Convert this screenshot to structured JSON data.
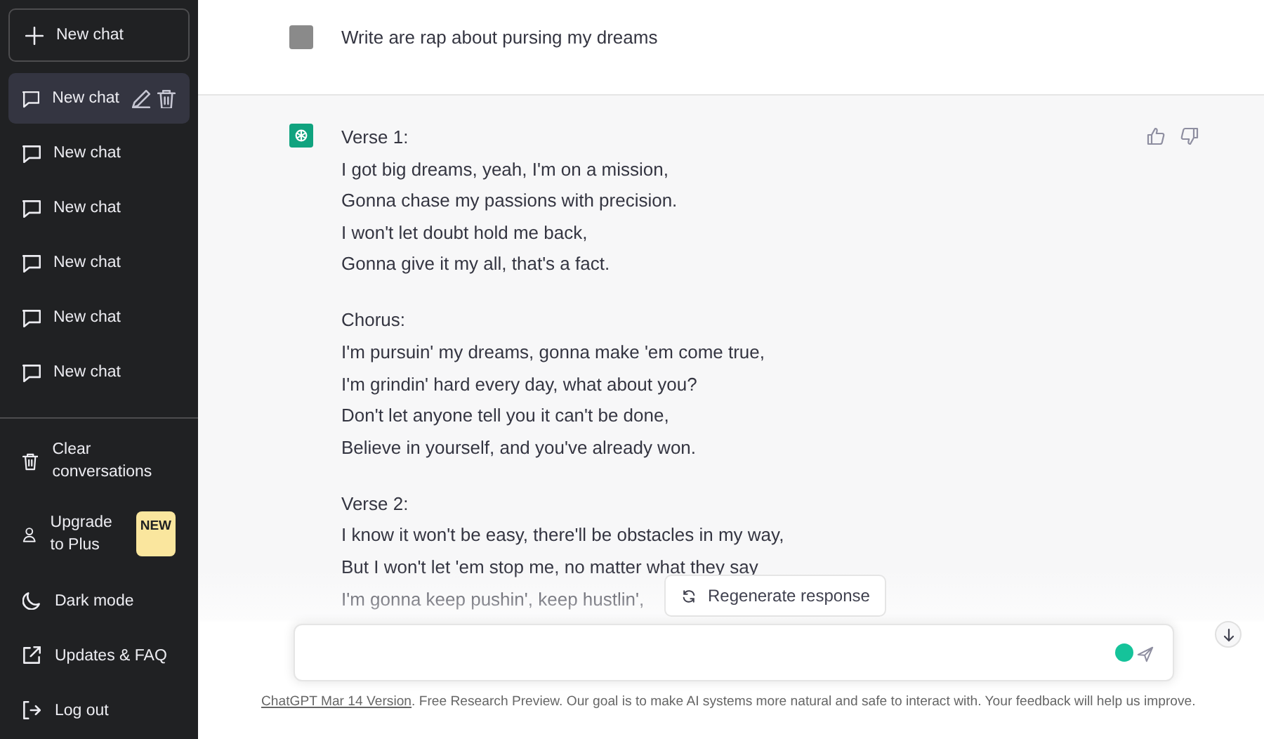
{
  "sidebar": {
    "new_chat_label": "New chat",
    "chats": [
      {
        "label": "New chat",
        "selected": true
      },
      {
        "label": "New chat",
        "selected": false
      },
      {
        "label": "New chat",
        "selected": false
      },
      {
        "label": "New chat",
        "selected": false
      },
      {
        "label": "New chat",
        "selected": false
      },
      {
        "label": "New chat",
        "selected": false
      }
    ],
    "actions": [
      {
        "kind": "clear",
        "label": "Clear conversations"
      },
      {
        "kind": "upgrade",
        "label": "Upgrade to Plus",
        "badge": "NEW"
      },
      {
        "kind": "theme",
        "label": "Dark mode"
      },
      {
        "kind": "updates",
        "label": "Updates & FAQ"
      },
      {
        "kind": "logout",
        "label": "Log out"
      }
    ]
  },
  "conversation": {
    "user_message": "Write are rap about pursing my dreams",
    "response": [
      {
        "lines": [
          "Verse 1:",
          "I got big dreams, yeah, I'm on a mission,",
          "Gonna chase my passions with precision.",
          "I won't let doubt hold me back,",
          "Gonna give it my all, that's a fact."
        ]
      },
      {
        "lines": [
          "Chorus:",
          "I'm pursuin' my dreams, gonna make 'em come true,",
          "I'm grindin' hard every day, what about you?",
          "Don't let anyone tell you it can't be done,",
          "Believe in yourself, and you've already won."
        ]
      },
      {
        "lines": [
          "Verse 2:",
          "I know it won't be easy, there'll be obstacles in my way,",
          "But I won't let 'em stop me, no matter what they say",
          "I'm gonna keep pushin', keep hustlin',"
        ]
      }
    ],
    "regenerate_label": "Regenerate response",
    "footer": {
      "link": "ChatGPT Mar 14 Version",
      "text": ". Free Research Preview. Our goal is to make AI systems more natural and safe to interact with. Your feedback will help us improve."
    }
  }
}
